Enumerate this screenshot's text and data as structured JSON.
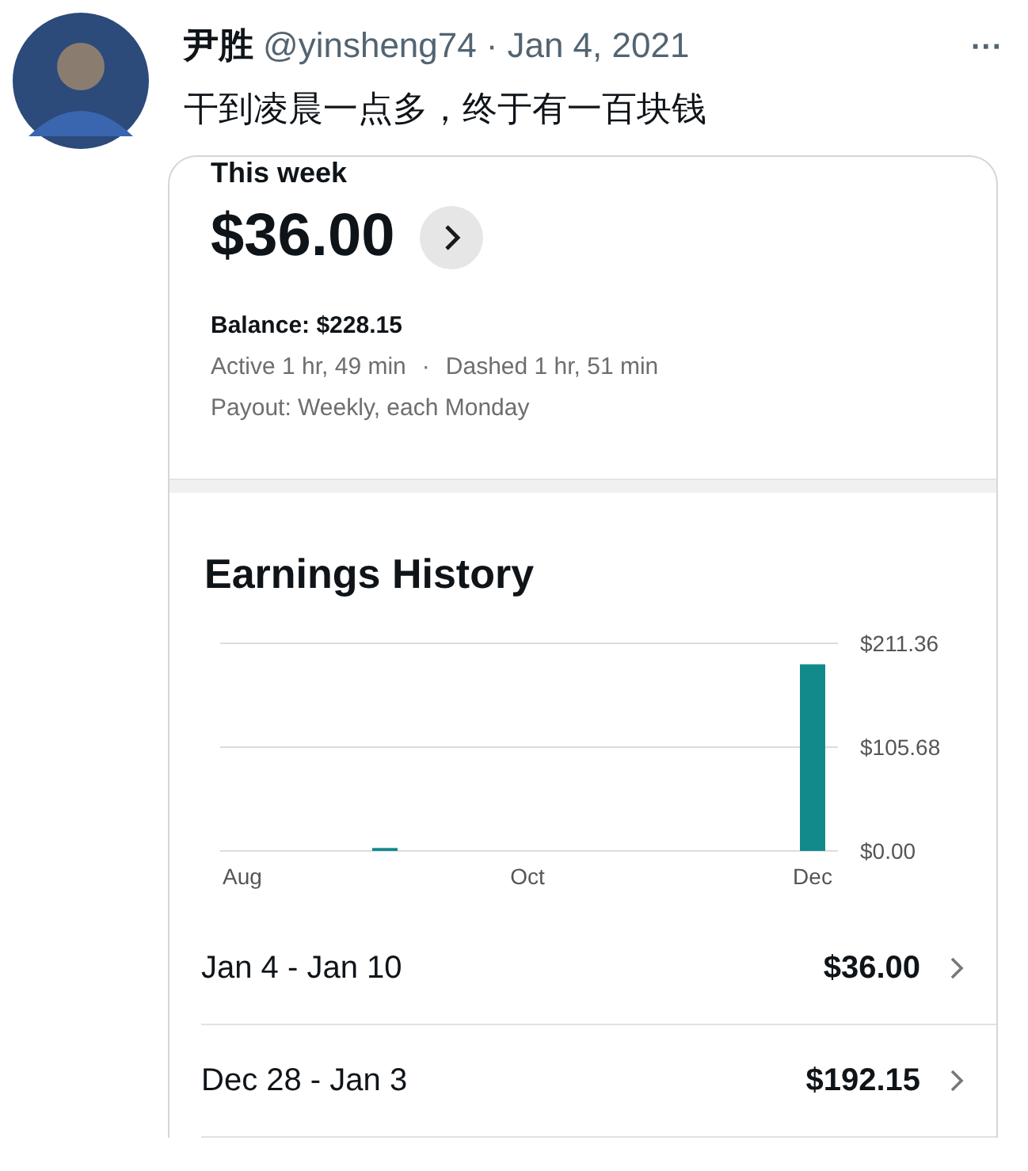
{
  "post": {
    "author": "尹胜",
    "handle": "@yinsheng74",
    "separator": "·",
    "date": "Jan 4, 2021",
    "more": "···",
    "text": "干到凌晨一点多，终于有一百块钱"
  },
  "summary": {
    "label": "This week",
    "amount": "$36.00",
    "balance": "Balance: $228.15",
    "active": "Active 1 hr, 49 min",
    "dot": "·",
    "dashed": "Dashed 1 hr, 51 min",
    "payout": "Payout: Weekly, each Monday"
  },
  "history": {
    "title": "Earnings History",
    "chart_data": {
      "type": "bar",
      "categories": [
        "Aug",
        null,
        "Oct",
        null,
        "Dec"
      ],
      "series": [
        {
          "color": "#128a8c",
          "values": [
            0,
            3,
            0,
            0,
            190
          ]
        }
      ],
      "ylim": [
        0,
        211.36
      ],
      "yticks": [
        {
          "value": 0,
          "label": "$0.00"
        },
        {
          "value": 105.68,
          "label": "$105.68"
        },
        {
          "value": 211.36,
          "label": "$211.36"
        }
      ]
    },
    "weeks": [
      {
        "range": "Jan 4 - Jan 10",
        "amount": "$36.00"
      },
      {
        "range": "Dec 28 - Jan 3",
        "amount": "$192.15"
      }
    ]
  }
}
